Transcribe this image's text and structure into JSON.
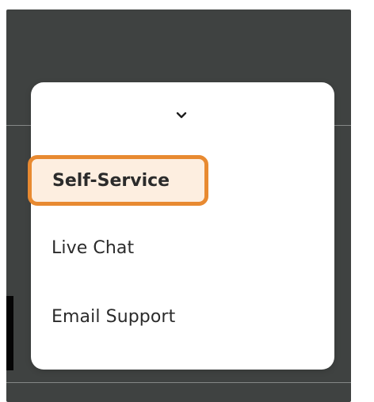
{
  "menu": {
    "toggle_icon": "chevron-down-icon",
    "items": [
      {
        "label": "Self-Service",
        "selected": true
      },
      {
        "label": "Live Chat",
        "selected": false
      },
      {
        "label": "Email Support",
        "selected": false
      }
    ]
  },
  "colors": {
    "background": "#3f4241",
    "highlight_border": "#e88a31",
    "highlight_fill": "#fdeee0",
    "text": "#2b2b2b"
  }
}
